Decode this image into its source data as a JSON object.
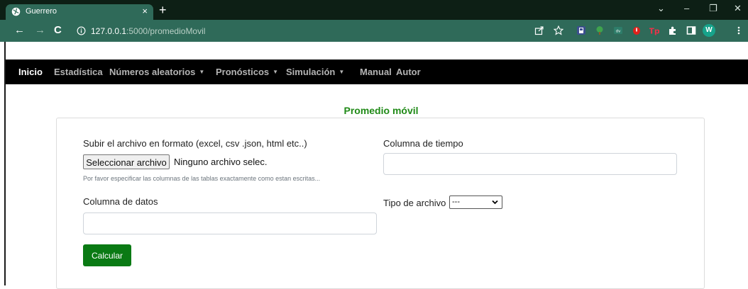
{
  "browser": {
    "tab_title": "Guerrero",
    "tab_close": "×",
    "new_tab": "+",
    "window_controls": {
      "dropdown": "⌄",
      "minimize": "–",
      "maximize": "❐",
      "close": "✕"
    },
    "nav": {
      "back": "←",
      "forward": "→",
      "reload": "C"
    },
    "url_host": "127.0.0.1",
    "url_rest": ":5000/promedioMovil",
    "profile_letter": "W",
    "toolbar_icons": [
      "share-icon",
      "star-icon",
      "extension-1-icon",
      "extension-tree-icon",
      "extension-dv-icon",
      "extension-red-icon",
      "extension-tp-icon",
      "puzzle-icon",
      "sidebar-icon",
      "profile-avatar",
      "kebab-menu-icon"
    ]
  },
  "navbar": {
    "items": [
      {
        "label": "Inicio",
        "active": true
      },
      {
        "label": "Estadística"
      },
      {
        "label": "Números aleatorios",
        "dropdown": true
      },
      {
        "label": "Pronósticos",
        "dropdown": true
      },
      {
        "label": "Simulación",
        "dropdown": true
      },
      {
        "label": "Manual"
      },
      {
        "label": "Autor"
      }
    ],
    "caret": "▼"
  },
  "page": {
    "title": "Promedio móvil",
    "upload_label": "Subir el archivo en formato (excel, csv .json, html etc..)",
    "file_button": "Seleccionar archivo",
    "file_status": "Ninguno archivo selec.",
    "help_text": "Por favor especificar las columnas de las tablas exactamente como estan escritas...",
    "data_column_label": "Columna de datos",
    "data_column_value": "",
    "time_column_label": "Columna de tiempo",
    "time_column_value": "",
    "file_type_label": "Tipo de archivo",
    "file_type_selected": "---",
    "calculate_button": "Calcular"
  },
  "colors": {
    "tab_bg": "#2f6a59",
    "title_green": "#208a17",
    "button_green": "#0a7a14",
    "navbar_bg": "#000000"
  }
}
